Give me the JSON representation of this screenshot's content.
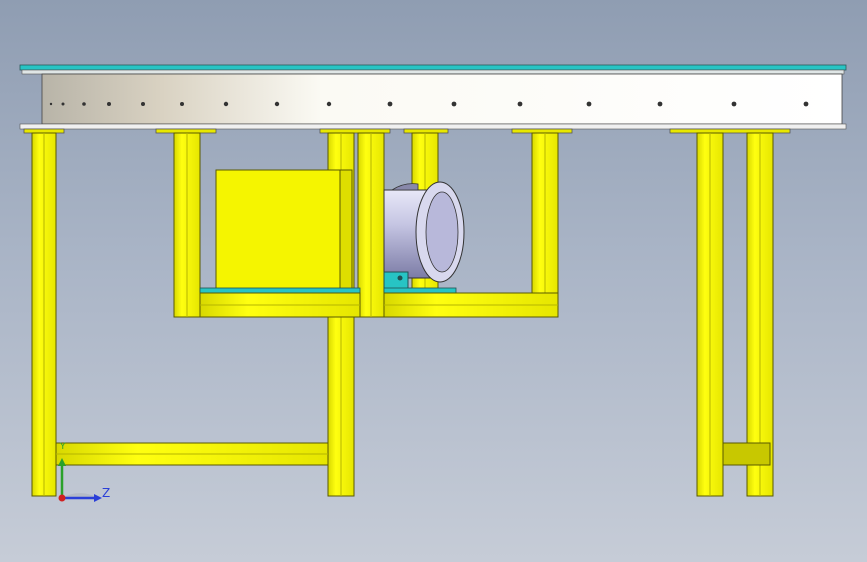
{
  "viewport": {
    "background_top": "#8f9db2",
    "background_bottom": "#c6ccd7"
  },
  "model": {
    "frame_color": "#f5f500",
    "frame_edge_color": "#6b6b00",
    "plate_color": "#27c4c4",
    "motor_color": "#c9c9ea",
    "beam_color": "#ffffff",
    "parts": [
      "conveyor-beam",
      "support-legs",
      "motor-box",
      "drum-motor",
      "motor-base-plate",
      "cross-bars"
    ]
  },
  "triad": {
    "y_label": "Y",
    "z_label": "Z",
    "y_color": "#2ba12b",
    "z_color": "#2a3fd8",
    "x_color": "#d02020"
  }
}
